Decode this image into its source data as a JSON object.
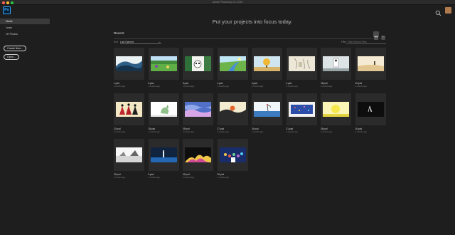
{
  "window": {
    "title": "Adobe Photoshop CC 2019"
  },
  "app": {
    "logo_text": "Ps"
  },
  "sidebar": {
    "items": [
      {
        "label": "Home",
        "active": true
      },
      {
        "label": "Learn",
        "active": false
      },
      {
        "label": "LR Photos",
        "active": false
      }
    ],
    "create_new_label": "Create New...",
    "open_label": "Open..."
  },
  "hero": {
    "headline": "Put your projects into focus today."
  },
  "recent": {
    "title": "Recent",
    "sort_label": "Sort",
    "sort_value": "Last Opened",
    "filter_label": "Filter",
    "filter_placeholder": "Filter Recent Files",
    "files": [
      {
        "name": "1.psd",
        "age": "4 months ago",
        "art": "stripes"
      },
      {
        "name": "6.psd",
        "age": "4 months ago",
        "art": "hills"
      },
      {
        "name": "5.psd",
        "age": "4 months ago",
        "art": "panda"
      },
      {
        "name": "4.psd",
        "age": "4 months ago",
        "art": "river"
      },
      {
        "name": "3.psd",
        "age": "4 months ago",
        "art": "tree"
      },
      {
        "name": "2.psd",
        "age": "4 months ago",
        "art": "sketch"
      },
      {
        "name": "18.psd",
        "age": "4 months ago",
        "art": "figure"
      },
      {
        "name": "19.psd",
        "age": "4 months ago",
        "art": "sandy"
      },
      {
        "name": "10.psd",
        "age": "4 months ago",
        "art": "threegirls"
      },
      {
        "name": "28.psd",
        "age": "4 months ago",
        "art": "cat"
      },
      {
        "name": "39.psd",
        "age": "4 months ago",
        "art": "waves"
      },
      {
        "name": "27.psd",
        "age": "4 months ago",
        "art": "sunset"
      },
      {
        "name": "24.psd",
        "age": "4 months ago",
        "art": "bird"
      },
      {
        "name": "21.psd",
        "age": "4 months ago",
        "art": "sparkle"
      },
      {
        "name": "26.psd",
        "age": "4 months ago",
        "art": "yellow"
      },
      {
        "name": "16.psd",
        "age": "4 months ago",
        "art": "ink"
      },
      {
        "name": "22.psd",
        "age": "4 months ago",
        "art": "lake"
      },
      {
        "name": "5.psd",
        "age": "4 months ago",
        "art": "night"
      },
      {
        "name": "20.psd",
        "age": "4 months ago",
        "art": "fire"
      },
      {
        "name": "39.psd",
        "age": "4 months ago",
        "art": "crowd"
      }
    ]
  },
  "colors": {
    "background": "#1e1e1e",
    "tile_bg": "#2b2b2b",
    "accent": "#31a8ff"
  }
}
